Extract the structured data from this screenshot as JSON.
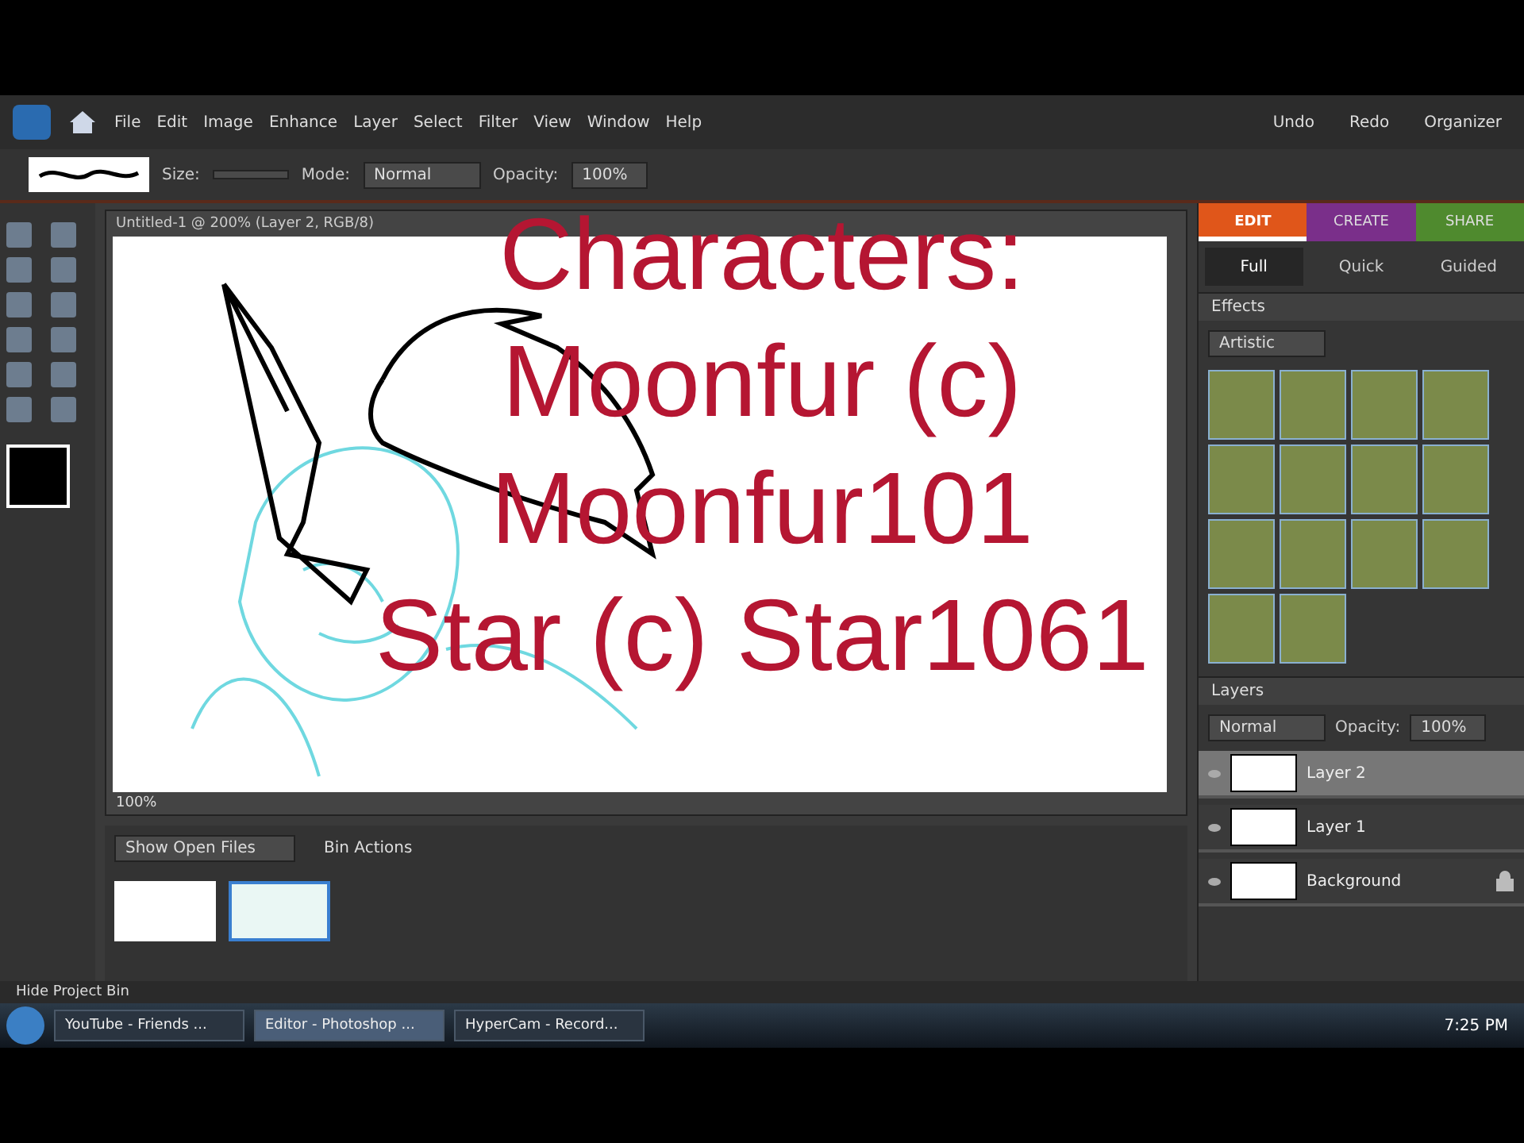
{
  "menu_bar": {
    "items": [
      "File",
      "Edit",
      "Image",
      "Enhance",
      "Layer",
      "Select",
      "Filter",
      "View",
      "Window",
      "Help"
    ],
    "actions": [
      "Undo",
      "Redo",
      "Organizer"
    ]
  },
  "tool_options": {
    "size_label": "Size:",
    "mode_label": "Mode:",
    "mode_value": "Normal",
    "opacity_label": "Opacity:",
    "opacity_value": "100%"
  },
  "document": {
    "title": "Untitled-1 @ 200% (Layer 2, RGB/8)",
    "zoom": "100%"
  },
  "overlay_text": [
    "Characters:",
    "Moonfur (c)",
    "Moonfur101",
    "Star (c) Star1061"
  ],
  "workspace_tabs": [
    {
      "label": "EDIT",
      "color": "#e0561a",
      "selected": true
    },
    {
      "label": "CREATE",
      "color": "#7a2f8a",
      "selected": false
    },
    {
      "label": "SHARE",
      "color": "#4f8a2e",
      "selected": false
    }
  ],
  "edit_modes": [
    {
      "label": "Full",
      "selected": true
    },
    {
      "label": "Quick",
      "selected": false
    },
    {
      "label": "Guided",
      "selected": false
    }
  ],
  "effects": {
    "title": "Effects",
    "filter": "Artistic"
  },
  "layers": {
    "title": "Layers",
    "blend_mode": "Normal",
    "opacity_label": "Opacity:",
    "opacity_value": "100%",
    "items": [
      {
        "name": "Layer 2",
        "selected": true,
        "locked": false
      },
      {
        "name": "Layer 1",
        "selected": false,
        "locked": false
      },
      {
        "name": "Background",
        "selected": false,
        "locked": true
      }
    ]
  },
  "project_bin": {
    "show": "Show Open Files",
    "actions": "Bin Actions",
    "files": [
      {
        "selected": false
      },
      {
        "selected": true
      }
    ]
  },
  "status_bar": {
    "hide_bin": "Hide Project Bin"
  },
  "taskbar": {
    "windows": [
      {
        "label": "YouTube - Friends ...",
        "selected": false
      },
      {
        "label": "Editor - Photoshop ...",
        "selected": true
      },
      {
        "label": "HyperCam - Record...",
        "selected": false
      }
    ],
    "clock": "7:25 PM"
  }
}
